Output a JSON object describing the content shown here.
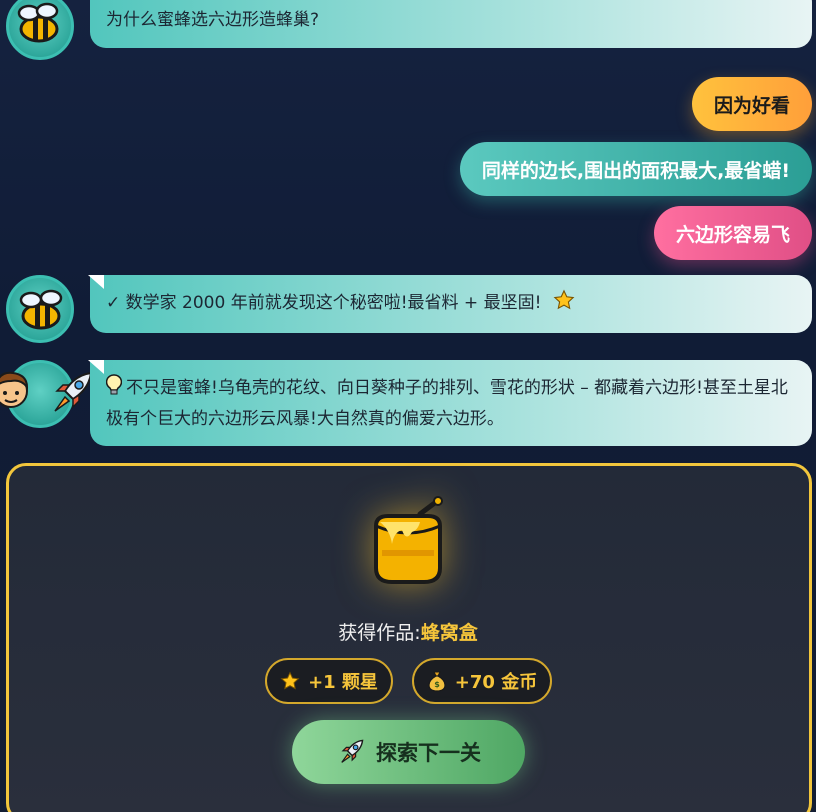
{
  "messages": {
    "m1": "为什么蜜蜂选六边形造蜂巢?",
    "m2": "✓ 数学家 2000 年前就发现这个秘密啦!最省料 + 最坚固!",
    "m3": "不只是蜜蜂!乌龟壳的花纹、向日葵种子的排列、雪花的形状 – 都藏着六边形!甚至土星北极有个巨大的六边形云风暴!大自然真的偏爱六边形。"
  },
  "choices": [
    "因为好看",
    "同样的边长,围出的面积最大,最省蜡!",
    "六边形容易飞"
  ],
  "reward": {
    "label": "获得作品:",
    "item_name": "蜂窝盒",
    "star_reward": "+1 颗星",
    "coin_reward": "+70 金币",
    "button": "探索下一关"
  },
  "icons": [
    "bee-icon",
    "boy-icon",
    "rocket-icon",
    "star-icon",
    "lightbulb-icon",
    "honey-pot-icon",
    "money-bag-icon"
  ],
  "colors": {
    "accent_gold": "#f6c53b",
    "teal": "#3cbfb2",
    "pink": "#e04f86",
    "orange": "#ff9f3a",
    "green": "#4fa764"
  }
}
